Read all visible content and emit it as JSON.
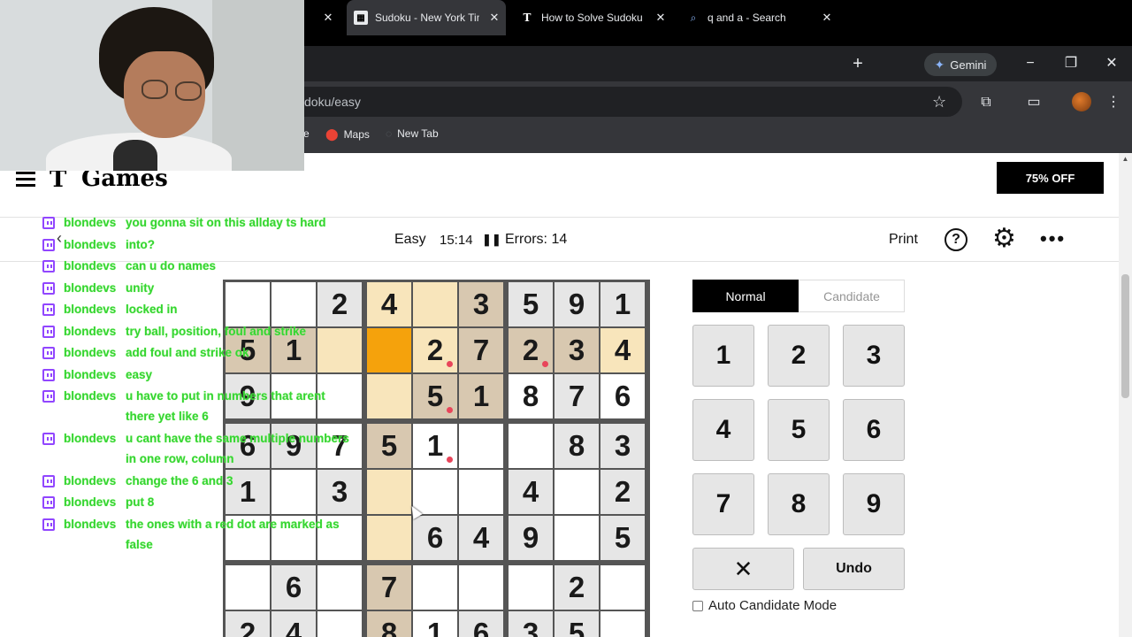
{
  "browser": {
    "tabs": [
      {
        "title": "Sudoku - New York Tim",
        "favicon": "nyt-games-icon",
        "active": true
      },
      {
        "title": "How to Solve Sudoku",
        "favicon": "nyt-icon",
        "active": false
      },
      {
        "title": "q and a - Search",
        "favicon": "search-icon",
        "active": false
      }
    ],
    "new_tab_symbol": "+",
    "gemini_label": "Gemini",
    "url": "doku/easy",
    "bookmarks": [
      {
        "label": "e"
      },
      {
        "label": "Maps",
        "icon": "maps-pin-icon"
      },
      {
        "label": "New Tab",
        "icon": "globe-icon"
      }
    ]
  },
  "header": {
    "logo_mark": "T",
    "logo_text": "Games",
    "offer_label": "75% OFF"
  },
  "game": {
    "difficulty": "Easy",
    "timer": "15:14",
    "errors_label": "Errors: 14",
    "print_label": "Print",
    "help_symbol": "?",
    "back_symbol": "‹",
    "grid": [
      [
        "",
        "",
        "2",
        "4",
        "",
        "3",
        "5",
        "9",
        "1"
      ],
      [
        "5",
        "1",
        "",
        "",
        "2",
        "7",
        "2",
        "3",
        "4"
      ],
      [
        "9",
        "",
        "",
        "",
        "5",
        "1",
        "8",
        "7",
        "6"
      ],
      [
        "6",
        "9",
        "7",
        "5",
        "1",
        "",
        "",
        "8",
        "3"
      ],
      [
        "1",
        "",
        "3",
        "",
        "",
        "",
        "4",
        "",
        "2"
      ],
      [
        "",
        "",
        "",
        "",
        "6",
        "4",
        "9",
        "",
        "5"
      ],
      [
        "",
        "6",
        "",
        "7",
        "",
        "",
        "",
        "2",
        ""
      ],
      [
        "2",
        "4",
        "",
        "8",
        "1",
        "6",
        "3",
        "5",
        ""
      ]
    ],
    "error_dots": [
      [
        1,
        4
      ],
      [
        1,
        6
      ],
      [
        2,
        4
      ],
      [
        3,
        4
      ]
    ],
    "selected_cell": [
      1,
      3
    ],
    "colors": {
      "selected": "#f5a20c",
      "highlight": "#f8e5bb",
      "same_number": "#d8c8b0",
      "given": "#e6e6e6",
      "error_dot": "#e8455a"
    }
  },
  "controls": {
    "mode_normal": "Normal",
    "mode_candidate": "Candidate",
    "keys": [
      "1",
      "2",
      "3",
      "4",
      "5",
      "6",
      "7",
      "8",
      "9"
    ],
    "erase_symbol": "✕",
    "undo_label": "Undo",
    "auto_candidate_label": "Auto Candidate Mode"
  },
  "chat": [
    {
      "user": "blondevs",
      "text": "you gonna sit on this allday ts hard"
    },
    {
      "user": "blondevs",
      "text": "into?"
    },
    {
      "user": "blondevs",
      "text": "can u do names"
    },
    {
      "user": "blondevs",
      "text": "unity"
    },
    {
      "user": "blondevs",
      "text": "locked in"
    },
    {
      "user": "blondevs",
      "text": "try ball, position, foul and strike"
    },
    {
      "user": "blondevs",
      "text": "add foul and strike ok"
    },
    {
      "user": "blondevs",
      "text": "easy"
    },
    {
      "user": "blondevs",
      "text": "u have to put in numbers that arent there yet like 6"
    },
    {
      "user": "blondevs",
      "text": "u cant have the same multiple numbers in one row, column"
    },
    {
      "user": "blondevs",
      "text": "change the 6 and 3"
    },
    {
      "user": "blondevs",
      "text": "put 8"
    },
    {
      "user": "blondevs",
      "text": "the ones with a red dot are marked as false"
    }
  ]
}
